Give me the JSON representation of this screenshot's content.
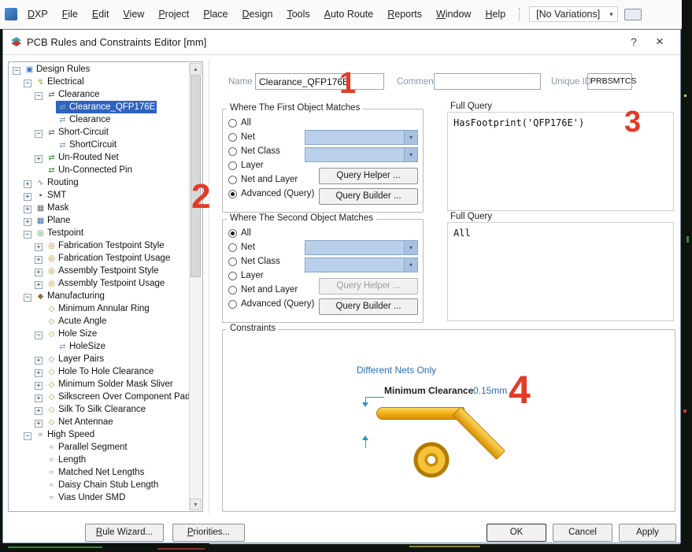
{
  "menu": {
    "items": [
      "DXP",
      "File",
      "Edit",
      "View",
      "Project",
      "Place",
      "Design",
      "Tools",
      "Auto Route",
      "Reports",
      "Window",
      "Help"
    ],
    "variations": "[No Variations]"
  },
  "dialog": {
    "title": "PCB Rules and Constraints Editor [mm]",
    "help": "?",
    "close": "×"
  },
  "icons": {
    "root": {
      "glyph": "▣",
      "color": "#3a7dbd"
    },
    "electrical": {
      "glyph": "↯",
      "color": "#c9992a"
    },
    "category": {
      "glyph": "⇄",
      "color": "#3f8f3f"
    },
    "leaf": {
      "glyph": "⇄",
      "color": "#7aa5c9"
    },
    "routing": {
      "glyph": "∿",
      "color": "#8a5fb0"
    },
    "smt": {
      "glyph": "▪",
      "color": "#6b4a32"
    },
    "mask": {
      "glyph": "▦",
      "color": "#6a6a6a"
    },
    "plane": {
      "glyph": "▦",
      "color": "#3f6fae"
    },
    "testpoint": {
      "glyph": "◎",
      "color": "#3f8f3f"
    },
    "tp-child": {
      "glyph": "◎",
      "color": "#b08f2a"
    },
    "manufacturing": {
      "glyph": "◆",
      "color": "#8a7340"
    },
    "mfg-child": {
      "glyph": "◇",
      "color": "#b08f2a"
    },
    "highspeed": {
      "glyph": "≈",
      "color": "#3f8f3f"
    },
    "hs-child": {
      "glyph": "≈",
      "color": "#7a9fc0"
    }
  },
  "tree": {
    "items": [
      {
        "label": "Design Rules",
        "depth": 0,
        "expand": "minus",
        "icon": "root"
      },
      {
        "label": "Electrical",
        "depth": 1,
        "expand": "minus",
        "icon": "electrical"
      },
      {
        "label": "Clearance",
        "depth": 2,
        "expand": "minus",
        "icon": "category"
      },
      {
        "label": "Clearance_QFP176E",
        "depth": 3,
        "expand": null,
        "icon": "leaf",
        "selected": true
      },
      {
        "label": "Clearance",
        "depth": 3,
        "expand": null,
        "icon": "leaf"
      },
      {
        "label": "Short-Circuit",
        "depth": 2,
        "expand": "minus",
        "icon": "category"
      },
      {
        "label": "ShortCircuit",
        "depth": 3,
        "expand": null,
        "icon": "leaf"
      },
      {
        "label": "Un-Routed Net",
        "depth": 2,
        "expand": "plus",
        "icon": "category"
      },
      {
        "label": "Un-Connected Pin",
        "depth": 2,
        "expand": null,
        "icon": "category"
      },
      {
        "label": "Routing",
        "depth": 1,
        "expand": "plus",
        "icon": "routing"
      },
      {
        "label": "SMT",
        "depth": 1,
        "expand": "plus",
        "icon": "smt"
      },
      {
        "label": "Mask",
        "depth": 1,
        "expand": "plus",
        "icon": "mask"
      },
      {
        "label": "Plane",
        "depth": 1,
        "expand": "plus",
        "icon": "plane"
      },
      {
        "label": "Testpoint",
        "depth": 1,
        "expand": "minus",
        "icon": "testpoint"
      },
      {
        "label": "Fabrication Testpoint Style",
        "depth": 2,
        "expand": "plus",
        "icon": "tp-child"
      },
      {
        "label": "Fabrication Testpoint Usage",
        "depth": 2,
        "expand": "plus",
        "icon": "tp-child"
      },
      {
        "label": "Assembly Testpoint Style",
        "depth": 2,
        "expand": "plus",
        "icon": "tp-child"
      },
      {
        "label": "Assembly Testpoint Usage",
        "depth": 2,
        "expand": "plus",
        "icon": "tp-child"
      },
      {
        "label": "Manufacturing",
        "depth": 1,
        "expand": "minus",
        "icon": "manufacturing"
      },
      {
        "label": "Minimum Annular Ring",
        "depth": 2,
        "expand": null,
        "icon": "mfg-child"
      },
      {
        "label": "Acute Angle",
        "depth": 2,
        "expand": null,
        "icon": "mfg-child"
      },
      {
        "label": "Hole Size",
        "depth": 2,
        "expand": "minus",
        "icon": "mfg-child"
      },
      {
        "label": "HoleSize",
        "depth": 3,
        "expand": null,
        "icon": "leaf"
      },
      {
        "label": "Layer Pairs",
        "depth": 2,
        "expand": "plus",
        "icon": "mfg-child"
      },
      {
        "label": "Hole To Hole Clearance",
        "depth": 2,
        "expand": "plus",
        "icon": "mfg-child"
      },
      {
        "label": "Minimum Solder Mask Sliver",
        "depth": 2,
        "expand": "plus",
        "icon": "mfg-child"
      },
      {
        "label": "Silkscreen Over Component Pads",
        "depth": 2,
        "expand": "plus",
        "icon": "mfg-child"
      },
      {
        "label": "Silk To Silk Clearance",
        "depth": 2,
        "expand": "plus",
        "icon": "mfg-child"
      },
      {
        "label": "Net Antennae",
        "depth": 2,
        "expand": "plus",
        "icon": "mfg-child"
      },
      {
        "label": "High Speed",
        "depth": 1,
        "expand": "minus",
        "icon": "highspeed"
      },
      {
        "label": "Parallel Segment",
        "depth": 2,
        "expand": null,
        "icon": "hs-child"
      },
      {
        "label": "Length",
        "depth": 2,
        "expand": null,
        "icon": "hs-child"
      },
      {
        "label": "Matched Net Lengths",
        "depth": 2,
        "expand": null,
        "icon": "hs-child"
      },
      {
        "label": "Daisy Chain Stub Length",
        "depth": 2,
        "expand": null,
        "icon": "hs-child"
      },
      {
        "label": "Vias Under SMD",
        "depth": 2,
        "expand": null,
        "icon": "hs-child"
      }
    ]
  },
  "form": {
    "name": {
      "label": "Name",
      "value": "Clearance_QFP176E"
    },
    "comment": {
      "label": "Comment",
      "value": ""
    },
    "unique_id": {
      "label": "Unique ID",
      "value": "PRBSMTCS"
    },
    "first_match": {
      "title": "Where The First Object Matches",
      "options": [
        "All",
        "Net",
        "Net Class",
        "Layer",
        "Net and Layer",
        "Advanced (Query)"
      ],
      "selected_index": 5,
      "query_helper": "Query Helper ...",
      "query_builder": "Query Builder ...",
      "query_helper_enabled": true,
      "full_query_label": "Full Query",
      "full_query": "HasFootprint('QFP176E')"
    },
    "second_match": {
      "title": "Where The Second Object Matches",
      "options": [
        "All",
        "Net",
        "Net Class",
        "Layer",
        "Net and Layer",
        "Advanced (Query)"
      ],
      "selected_index": 0,
      "query_helper": "Query Helper ...",
      "query_builder": "Query Builder ...",
      "query_helper_enabled": false,
      "full_query_label": "Full Query",
      "full_query": "All"
    },
    "constraints": {
      "title": "Constraints",
      "different_nets": "Different Nets Only",
      "clearance_label": "Minimum Clearance",
      "clearance_value": "0.15mm"
    }
  },
  "footer": {
    "rule_wizard": "Rule Wizard...",
    "priorities": "Priorities...",
    "ok": "OK",
    "cancel": "Cancel",
    "apply": "Apply"
  },
  "annotations": {
    "n1": "1",
    "n2": "2",
    "n3": "3",
    "n4": "4"
  },
  "colors": {
    "annotation_red": "#e23c28",
    "selection_blue": "#2e63c0",
    "query_blue": "#2a6db8",
    "trace_gold": "#f3b31c"
  }
}
